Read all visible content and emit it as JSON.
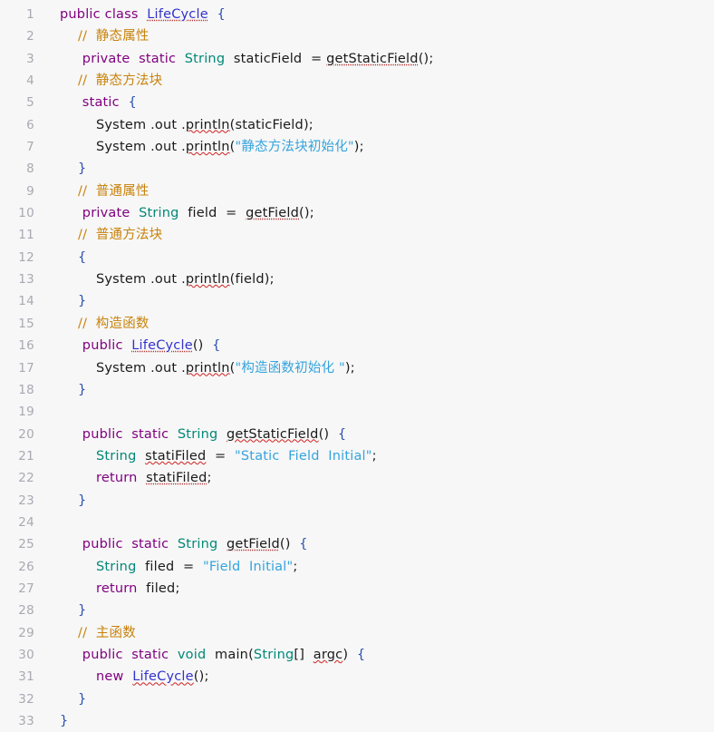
{
  "editor": {
    "language": "Java",
    "class_name": "LifeCycle",
    "background_color": "#f7f7f7",
    "gutter_color": "#a9a9b3",
    "first_line": 1,
    "last_line": 33,
    "total_lines": 33
  },
  "colors": {
    "keyword": "#800080",
    "type": "#008877",
    "string": "#35a4dd",
    "comment": "#c8820a",
    "plain": "#1a1a1a",
    "class_ref": "#3333cc",
    "brace": "#2a4fb0",
    "typo_underline": "#d02020",
    "ref_underline": "#b03030"
  },
  "lines": [
    {
      "n": "1",
      "indent": 0,
      "tokens": [
        {
          "t": "public",
          "c": "kw"
        },
        {
          "t": " ",
          "c": "plain"
        },
        {
          "t": "class",
          "c": "kw"
        },
        {
          "t": "  ",
          "c": "plain"
        },
        {
          "t": "LifeCycle",
          "c": "cls",
          "u": "dot"
        },
        {
          "t": "  ",
          "c": "plain"
        },
        {
          "t": "{",
          "c": "brace"
        }
      ]
    },
    {
      "n": "2",
      "indent": 1,
      "tokens": [
        {
          "t": "//  静态属性",
          "c": "cmt"
        }
      ]
    },
    {
      "n": "3",
      "indent": 1,
      "tokens": [
        {
          "t": " private",
          "c": "kw"
        },
        {
          "t": "  ",
          "c": "plain"
        },
        {
          "t": "static",
          "c": "kw"
        },
        {
          "t": "  ",
          "c": "plain"
        },
        {
          "t": "String",
          "c": "type"
        },
        {
          "t": "  ",
          "c": "plain"
        },
        {
          "t": "staticField",
          "c": "plain"
        },
        {
          "t": "  ",
          "c": "plain"
        },
        {
          "t": "=",
          "c": "op"
        },
        {
          "t": " ",
          "c": "plain"
        },
        {
          "t": "getStaticField",
          "c": "plain",
          "u": "dot"
        },
        {
          "t": "();",
          "c": "plain"
        }
      ]
    },
    {
      "n": "4",
      "indent": 1,
      "tokens": [
        {
          "t": "//  静态方法块",
          "c": "cmt"
        }
      ]
    },
    {
      "n": "5",
      "indent": 1,
      "tokens": [
        {
          "t": " static",
          "c": "kw"
        },
        {
          "t": "  ",
          "c": "plain"
        },
        {
          "t": "{",
          "c": "brace"
        }
      ]
    },
    {
      "n": "6",
      "indent": 2,
      "tokens": [
        {
          "t": "System",
          "c": "plain"
        },
        {
          "t": " .",
          "c": "plain"
        },
        {
          "t": "out",
          "c": "plain"
        },
        {
          "t": " .",
          "c": "plain"
        },
        {
          "t": "println",
          "c": "plain",
          "u": "wavy"
        },
        {
          "t": "(",
          "c": "plain"
        },
        {
          "t": "staticField",
          "c": "plain"
        },
        {
          "t": ");",
          "c": "plain"
        }
      ]
    },
    {
      "n": "7",
      "indent": 2,
      "tokens": [
        {
          "t": "System",
          "c": "plain"
        },
        {
          "t": " .",
          "c": "plain"
        },
        {
          "t": "out",
          "c": "plain"
        },
        {
          "t": " .",
          "c": "plain"
        },
        {
          "t": "println",
          "c": "plain",
          "u": "wavy"
        },
        {
          "t": "(",
          "c": "plain"
        },
        {
          "t": "\"静态方法块初始化\"",
          "c": "str"
        },
        {
          "t": ");",
          "c": "plain"
        }
      ]
    },
    {
      "n": "8",
      "indent": 1,
      "tokens": [
        {
          "t": "}",
          "c": "brace"
        }
      ]
    },
    {
      "n": "9",
      "indent": 1,
      "tokens": [
        {
          "t": "//  普通属性",
          "c": "cmt"
        }
      ]
    },
    {
      "n": "10",
      "indent": 1,
      "tokens": [
        {
          "t": " private",
          "c": "kw"
        },
        {
          "t": "  ",
          "c": "plain"
        },
        {
          "t": "String",
          "c": "type"
        },
        {
          "t": "  ",
          "c": "plain"
        },
        {
          "t": "field",
          "c": "plain"
        },
        {
          "t": "  ",
          "c": "plain"
        },
        {
          "t": "=",
          "c": "op"
        },
        {
          "t": "  ",
          "c": "plain"
        },
        {
          "t": "getField",
          "c": "plain",
          "u": "dot"
        },
        {
          "t": "();",
          "c": "plain"
        }
      ]
    },
    {
      "n": "11",
      "indent": 1,
      "tokens": [
        {
          "t": "//  普通方法块",
          "c": "cmt"
        }
      ]
    },
    {
      "n": "12",
      "indent": 1,
      "tokens": [
        {
          "t": "{",
          "c": "brace"
        }
      ]
    },
    {
      "n": "13",
      "indent": 2,
      "tokens": [
        {
          "t": "System",
          "c": "plain"
        },
        {
          "t": " .",
          "c": "plain"
        },
        {
          "t": "out",
          "c": "plain"
        },
        {
          "t": " .",
          "c": "plain"
        },
        {
          "t": "println",
          "c": "plain",
          "u": "wavy"
        },
        {
          "t": "(",
          "c": "plain"
        },
        {
          "t": "field",
          "c": "plain"
        },
        {
          "t": ");",
          "c": "plain"
        }
      ]
    },
    {
      "n": "14",
      "indent": 1,
      "tokens": [
        {
          "t": "}",
          "c": "brace"
        }
      ]
    },
    {
      "n": "15",
      "indent": 1,
      "tokens": [
        {
          "t": "//  构造函数",
          "c": "cmt"
        }
      ]
    },
    {
      "n": "16",
      "indent": 1,
      "tokens": [
        {
          "t": " public",
          "c": "kw"
        },
        {
          "t": "  ",
          "c": "plain"
        },
        {
          "t": "LifeCycle",
          "c": "cls",
          "u": "dot"
        },
        {
          "t": "()",
          "c": "plain"
        },
        {
          "t": "  ",
          "c": "plain"
        },
        {
          "t": "{",
          "c": "brace"
        }
      ]
    },
    {
      "n": "17",
      "indent": 2,
      "tokens": [
        {
          "t": "System",
          "c": "plain"
        },
        {
          "t": " .",
          "c": "plain"
        },
        {
          "t": "out",
          "c": "plain"
        },
        {
          "t": " .",
          "c": "plain"
        },
        {
          "t": "println",
          "c": "plain",
          "u": "wavy"
        },
        {
          "t": "(",
          "c": "plain"
        },
        {
          "t": "\"构造函数初始化 \"",
          "c": "str"
        },
        {
          "t": ");",
          "c": "plain"
        }
      ]
    },
    {
      "n": "18",
      "indent": 1,
      "tokens": [
        {
          "t": "}",
          "c": "brace"
        }
      ]
    },
    {
      "n": "19",
      "indent": 0,
      "tokens": []
    },
    {
      "n": "20",
      "indent": 1,
      "tokens": [
        {
          "t": " public",
          "c": "kw"
        },
        {
          "t": "  ",
          "c": "plain"
        },
        {
          "t": "static",
          "c": "kw"
        },
        {
          "t": "  ",
          "c": "plain"
        },
        {
          "t": "String",
          "c": "type"
        },
        {
          "t": "  ",
          "c": "plain"
        },
        {
          "t": "getStaticField",
          "c": "plain",
          "u": "wavy"
        },
        {
          "t": "()",
          "c": "plain"
        },
        {
          "t": "  ",
          "c": "plain"
        },
        {
          "t": "{",
          "c": "brace"
        }
      ]
    },
    {
      "n": "21",
      "indent": 2,
      "tokens": [
        {
          "t": "String",
          "c": "type"
        },
        {
          "t": "  ",
          "c": "plain"
        },
        {
          "t": "statiFiled",
          "c": "plain",
          "u": "wavy"
        },
        {
          "t": "  ",
          "c": "plain"
        },
        {
          "t": "=",
          "c": "op"
        },
        {
          "t": "  ",
          "c": "plain"
        },
        {
          "t": "\"Static  Field  Initial\"",
          "c": "str"
        },
        {
          "t": ";",
          "c": "plain"
        }
      ]
    },
    {
      "n": "22",
      "indent": 2,
      "tokens": [
        {
          "t": "return",
          "c": "kw"
        },
        {
          "t": "  ",
          "c": "plain"
        },
        {
          "t": "statiFiled",
          "c": "plain",
          "u": "dot"
        },
        {
          "t": ";",
          "c": "plain"
        }
      ]
    },
    {
      "n": "23",
      "indent": 1,
      "tokens": [
        {
          "t": "}",
          "c": "brace"
        }
      ]
    },
    {
      "n": "24",
      "indent": 0,
      "tokens": []
    },
    {
      "n": "25",
      "indent": 1,
      "tokens": [
        {
          "t": " public",
          "c": "kw"
        },
        {
          "t": "  ",
          "c": "plain"
        },
        {
          "t": "static",
          "c": "kw"
        },
        {
          "t": "  ",
          "c": "plain"
        },
        {
          "t": "String",
          "c": "type"
        },
        {
          "t": "  ",
          "c": "plain"
        },
        {
          "t": "getField",
          "c": "plain",
          "u": "dot"
        },
        {
          "t": "()",
          "c": "plain"
        },
        {
          "t": "  ",
          "c": "plain"
        },
        {
          "t": "{",
          "c": "brace"
        }
      ]
    },
    {
      "n": "26",
      "indent": 2,
      "tokens": [
        {
          "t": "String",
          "c": "type"
        },
        {
          "t": "  ",
          "c": "plain"
        },
        {
          "t": "filed",
          "c": "plain"
        },
        {
          "t": "  ",
          "c": "plain"
        },
        {
          "t": "=",
          "c": "op"
        },
        {
          "t": "  ",
          "c": "plain"
        },
        {
          "t": "\"Field  Initial\"",
          "c": "str"
        },
        {
          "t": ";",
          "c": "plain"
        }
      ]
    },
    {
      "n": "27",
      "indent": 2,
      "tokens": [
        {
          "t": "return",
          "c": "kw"
        },
        {
          "t": "  ",
          "c": "plain"
        },
        {
          "t": "filed",
          "c": "plain"
        },
        {
          "t": ";",
          "c": "plain"
        }
      ]
    },
    {
      "n": "28",
      "indent": 1,
      "tokens": [
        {
          "t": "}",
          "c": "brace"
        }
      ]
    },
    {
      "n": "29",
      "indent": 1,
      "tokens": [
        {
          "t": "//  主函数",
          "c": "cmt"
        }
      ]
    },
    {
      "n": "30",
      "indent": 1,
      "tokens": [
        {
          "t": " public",
          "c": "kw"
        },
        {
          "t": "  ",
          "c": "plain"
        },
        {
          "t": "static",
          "c": "kw"
        },
        {
          "t": "  ",
          "c": "plain"
        },
        {
          "t": "void",
          "c": "type"
        },
        {
          "t": "  ",
          "c": "plain"
        },
        {
          "t": "main",
          "c": "plain"
        },
        {
          "t": "(",
          "c": "plain"
        },
        {
          "t": "String",
          "c": "type"
        },
        {
          "t": "[]",
          "c": "plain"
        },
        {
          "t": "  ",
          "c": "plain"
        },
        {
          "t": "argc",
          "c": "plain",
          "u": "wavy"
        },
        {
          "t": ")",
          "c": "plain"
        },
        {
          "t": "  ",
          "c": "plain"
        },
        {
          "t": "{",
          "c": "brace"
        }
      ]
    },
    {
      "n": "31",
      "indent": 2,
      "tokens": [
        {
          "t": "new",
          "c": "kw"
        },
        {
          "t": "  ",
          "c": "plain"
        },
        {
          "t": "LifeCycle",
          "c": "cls",
          "u": "wavy"
        },
        {
          "t": "();",
          "c": "plain"
        }
      ]
    },
    {
      "n": "32",
      "indent": 1,
      "tokens": [
        {
          "t": "}",
          "c": "brace"
        }
      ]
    },
    {
      "n": "33",
      "indent": 0,
      "tokens": [
        {
          "t": "}",
          "c": "brace"
        }
      ]
    }
  ]
}
